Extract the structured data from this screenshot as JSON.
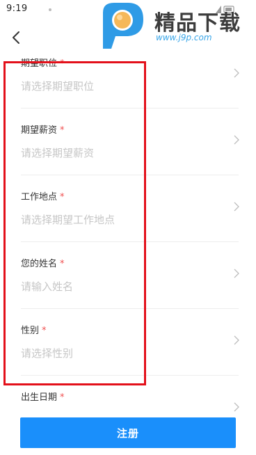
{
  "status_bar": {
    "time": "9:19"
  },
  "watermark": {
    "brand": "精品下载",
    "url": "www.j9p.com"
  },
  "form": {
    "required_mark": "*",
    "fields": [
      {
        "label": "期望职位",
        "placeholder": "请选择期望职位"
      },
      {
        "label": "期望薪资",
        "placeholder": "请选择期望薪资"
      },
      {
        "label": "工作地点",
        "placeholder": "请选择期望工作地点"
      },
      {
        "label": "您的姓名",
        "placeholder": "请输入姓名"
      },
      {
        "label": "性别",
        "placeholder": "请选择性别"
      },
      {
        "label": "出生日期",
        "placeholder": ""
      }
    ]
  },
  "register_button": {
    "label": "注册"
  },
  "colors": {
    "primary": "#1a8ffb",
    "required": "#f04f4f",
    "highlight": "#e3101a",
    "placeholder": "#c6c6c6"
  }
}
